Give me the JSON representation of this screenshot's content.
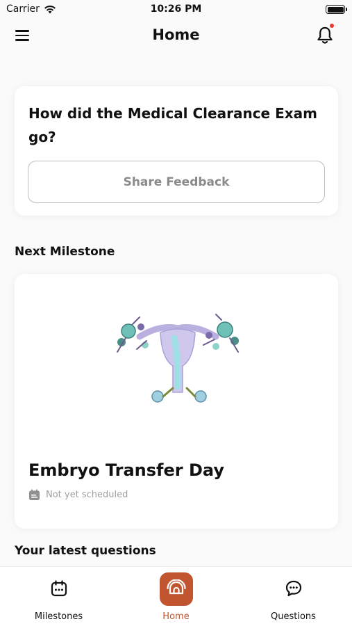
{
  "status_bar": {
    "carrier": "Carrier",
    "time": "10:26 PM"
  },
  "header": {
    "title": "Home",
    "menu_icon": "hamburger-menu-icon",
    "notification_icon": "bell-icon",
    "has_unread_notification": true
  },
  "feedback_card": {
    "question": "How did the Medical Clearance Exam go?",
    "button_label": "Share Feedback"
  },
  "next_milestone": {
    "heading": "Next Milestone",
    "title": "Embryo Transfer Day",
    "status": "Not yet scheduled",
    "status_icon": "calendar-icon",
    "illustration": "floral-uterus-illustration"
  },
  "latest_questions": {
    "heading": "Your latest questions"
  },
  "tab_bar": {
    "tabs": [
      {
        "label": "Milestones",
        "icon": "calendar-icon",
        "active": false
      },
      {
        "label": "Home",
        "icon": "home-icon",
        "active": true
      },
      {
        "label": "Questions",
        "icon": "chat-bubble-icon",
        "active": false
      }
    ]
  },
  "colors": {
    "accent": "#c0552f",
    "notification_dot": "#e53935",
    "muted_text": "#9e9e9e",
    "background": "#fafafa"
  }
}
